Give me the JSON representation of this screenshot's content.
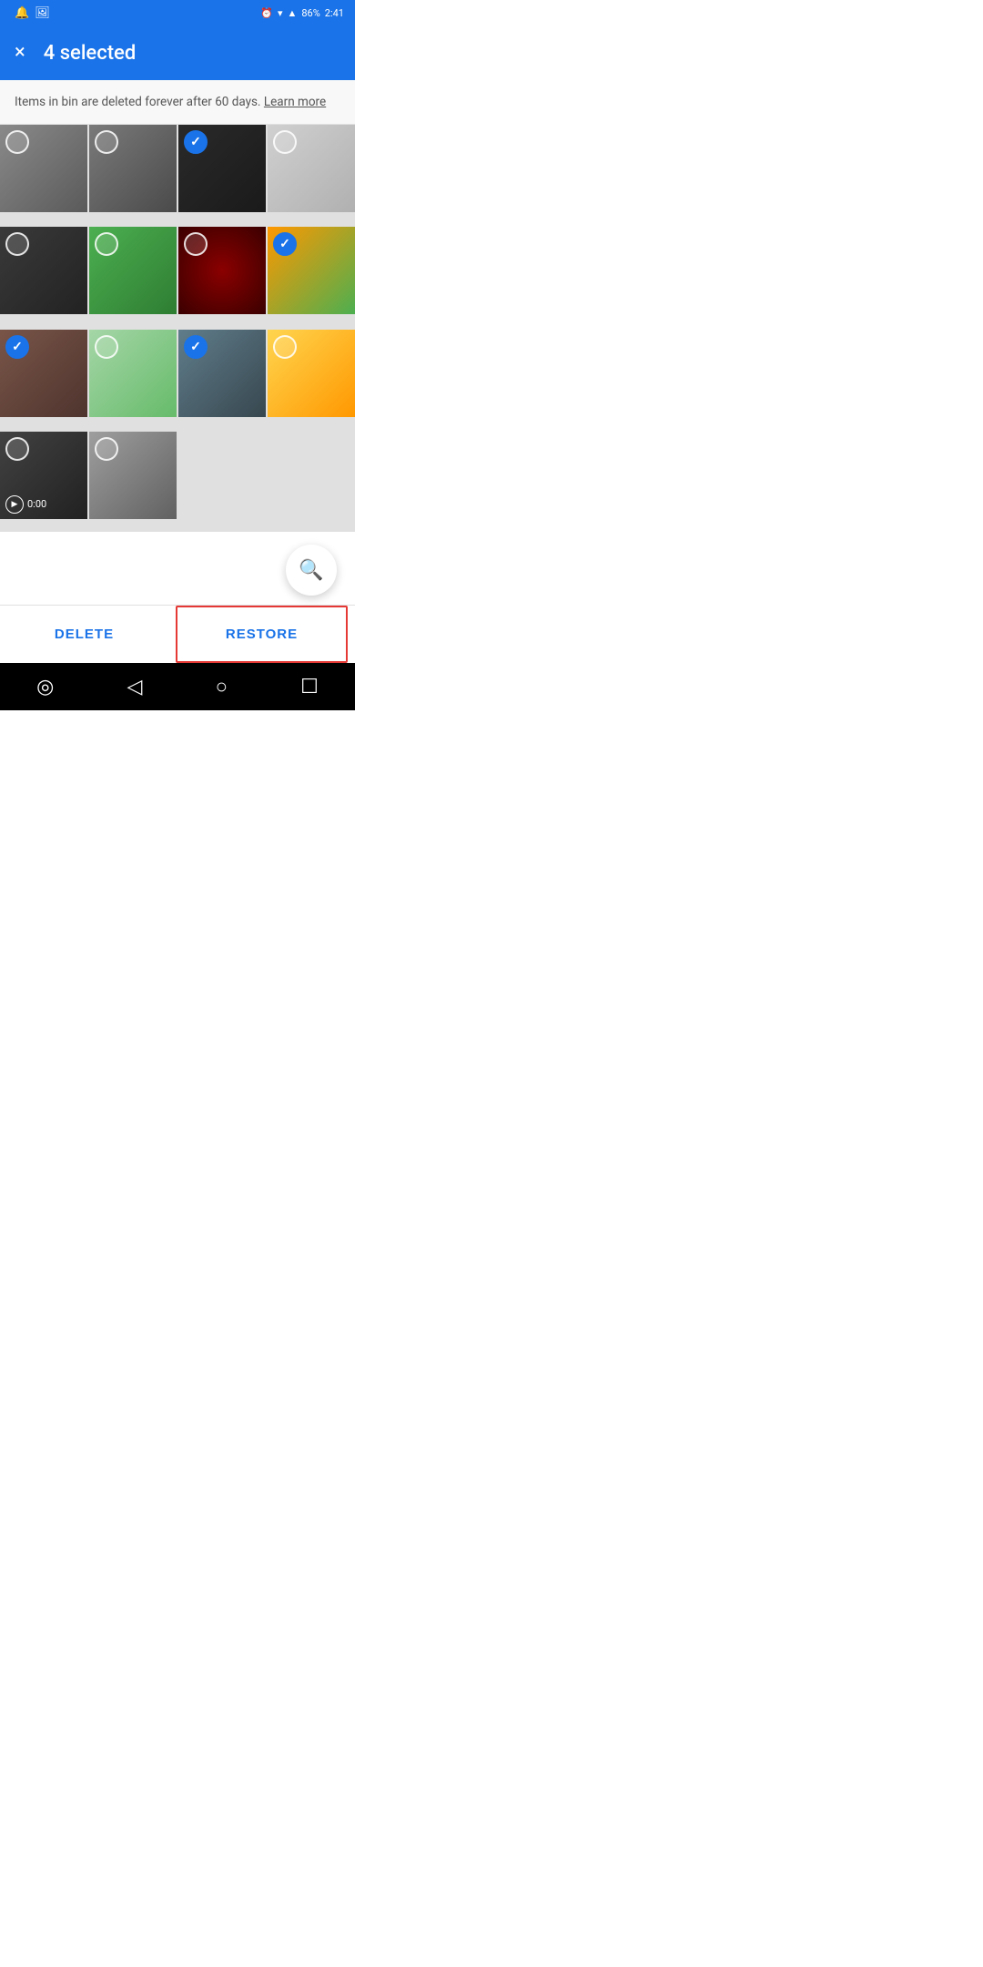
{
  "statusBar": {
    "battery": "86%",
    "time": "2:41",
    "leftIcons": [
      "notification-bell-icon",
      "image-icon"
    ]
  },
  "topBar": {
    "selectedCount": "4 selected",
    "closeLabel": "×"
  },
  "infoBanner": {
    "text": "Items in bin are deleted forever after 60 days.",
    "linkText": "Learn more"
  },
  "photos": [
    {
      "id": 1,
      "colorClass": "ph-gray-gate",
      "selected": false,
      "isVideo": false
    },
    {
      "id": 2,
      "colorClass": "ph-gray-gate2",
      "selected": false,
      "isVideo": false
    },
    {
      "id": 3,
      "colorClass": "ph-dark-screen",
      "selected": true,
      "isVideo": false
    },
    {
      "id": 4,
      "colorClass": "ph-tablet-text",
      "selected": false,
      "isVideo": false
    },
    {
      "id": 5,
      "colorClass": "ph-woman-black",
      "selected": false,
      "isVideo": false
    },
    {
      "id": 6,
      "colorClass": "ph-grass-feet",
      "selected": false,
      "isVideo": false
    },
    {
      "id": 7,
      "colorClass": "ph-red-bokeh",
      "selected": false,
      "isVideo": false
    },
    {
      "id": 8,
      "colorClass": "ph-colorful-face",
      "selected": true,
      "isVideo": false
    },
    {
      "id": 9,
      "colorClass": "ph-cake",
      "selected": true,
      "isVideo": false
    },
    {
      "id": 10,
      "colorClass": "ph-icecream",
      "selected": false,
      "isVideo": false
    },
    {
      "id": 11,
      "colorClass": "ph-phone-update",
      "selected": true,
      "isVideo": false
    },
    {
      "id": 12,
      "colorClass": "ph-boy-yellow",
      "selected": false,
      "isVideo": false
    },
    {
      "id": 13,
      "colorClass": "ph-laptop-dark",
      "selected": false,
      "isVideo": true,
      "duration": "0:00"
    },
    {
      "id": 14,
      "colorClass": "ph-keyboard",
      "selected": false,
      "isVideo": false
    }
  ],
  "fab": {
    "icon": "⊕",
    "label": "zoom"
  },
  "actionBar": {
    "deleteLabel": "DELETE",
    "restoreLabel": "RESTORE"
  },
  "navBar": {
    "icons": [
      "◎",
      "◁",
      "○",
      "☐"
    ]
  }
}
